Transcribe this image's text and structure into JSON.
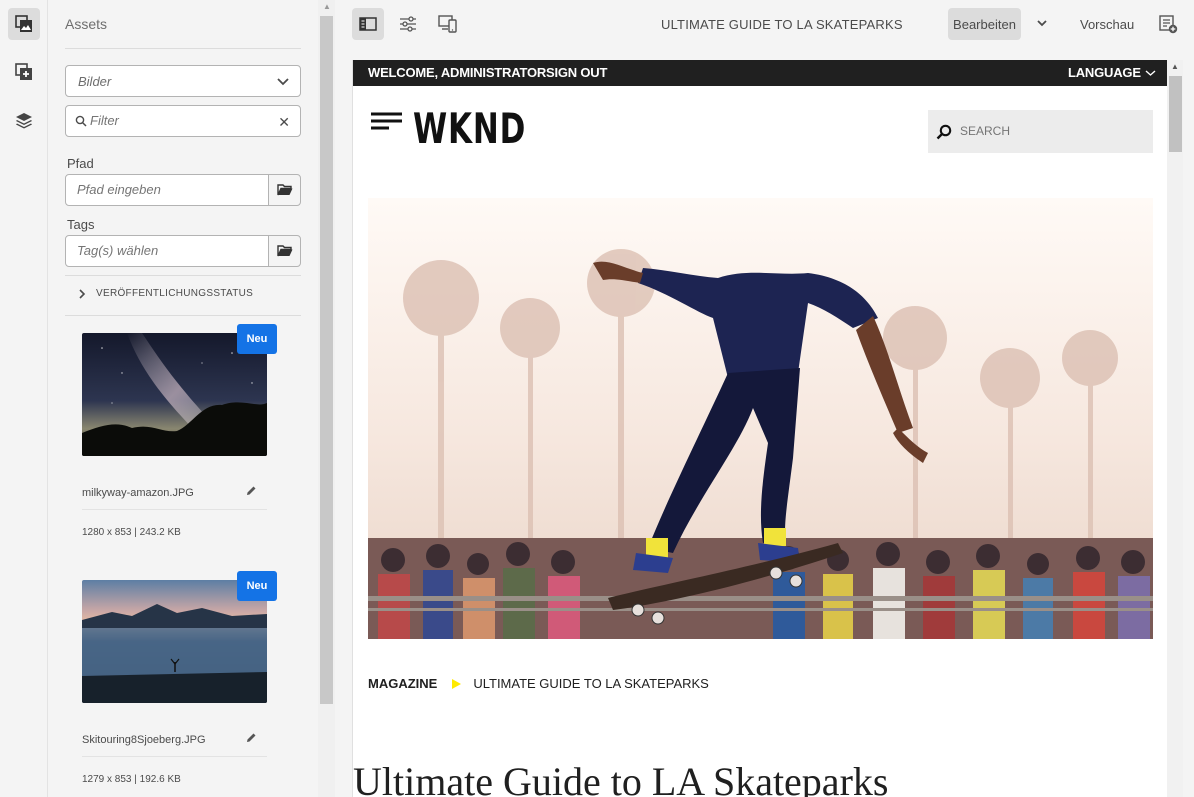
{
  "panel": {
    "title": "Assets",
    "type_select": "Bilder",
    "filter_placeholder": "Filter",
    "path_label": "Pfad",
    "path_placeholder": "Pfad eingeben",
    "tags_label": "Tags",
    "tags_placeholder": "Tag(s) wählen",
    "publication_status": "VERÖFFENTLICHUNGSSTATUS",
    "assets": [
      {
        "badge": "Neu",
        "name": "milkyway-amazon.JPG",
        "meta": "1280 x 853 | 243.2 KB"
      },
      {
        "badge": "Neu",
        "name": "Skitouring8Sjoeberg.JPG",
        "meta": "1279 x 853 | 192.6 KB"
      }
    ]
  },
  "toolbar": {
    "page_title": "ULTIMATE GUIDE TO LA SKATEPARKS",
    "edit_label": "Bearbeiten",
    "preview_label": "Vorschau"
  },
  "site": {
    "welcome": "WELCOME, ADMINISTRATOR",
    "signout": "SIGN OUT",
    "language": "LANGUAGE",
    "logo": "WKND",
    "search_placeholder": "SEARCH",
    "breadcrumb": [
      "MAGAZINE",
      "ULTIMATE GUIDE TO LA SKATEPARKS"
    ],
    "heading": "Ultimate Guide to LA Skateparks"
  },
  "colors": {
    "accent": "#1473e6",
    "breadcrumb_arrow": "#ffea00",
    "topbar": "#202020"
  }
}
